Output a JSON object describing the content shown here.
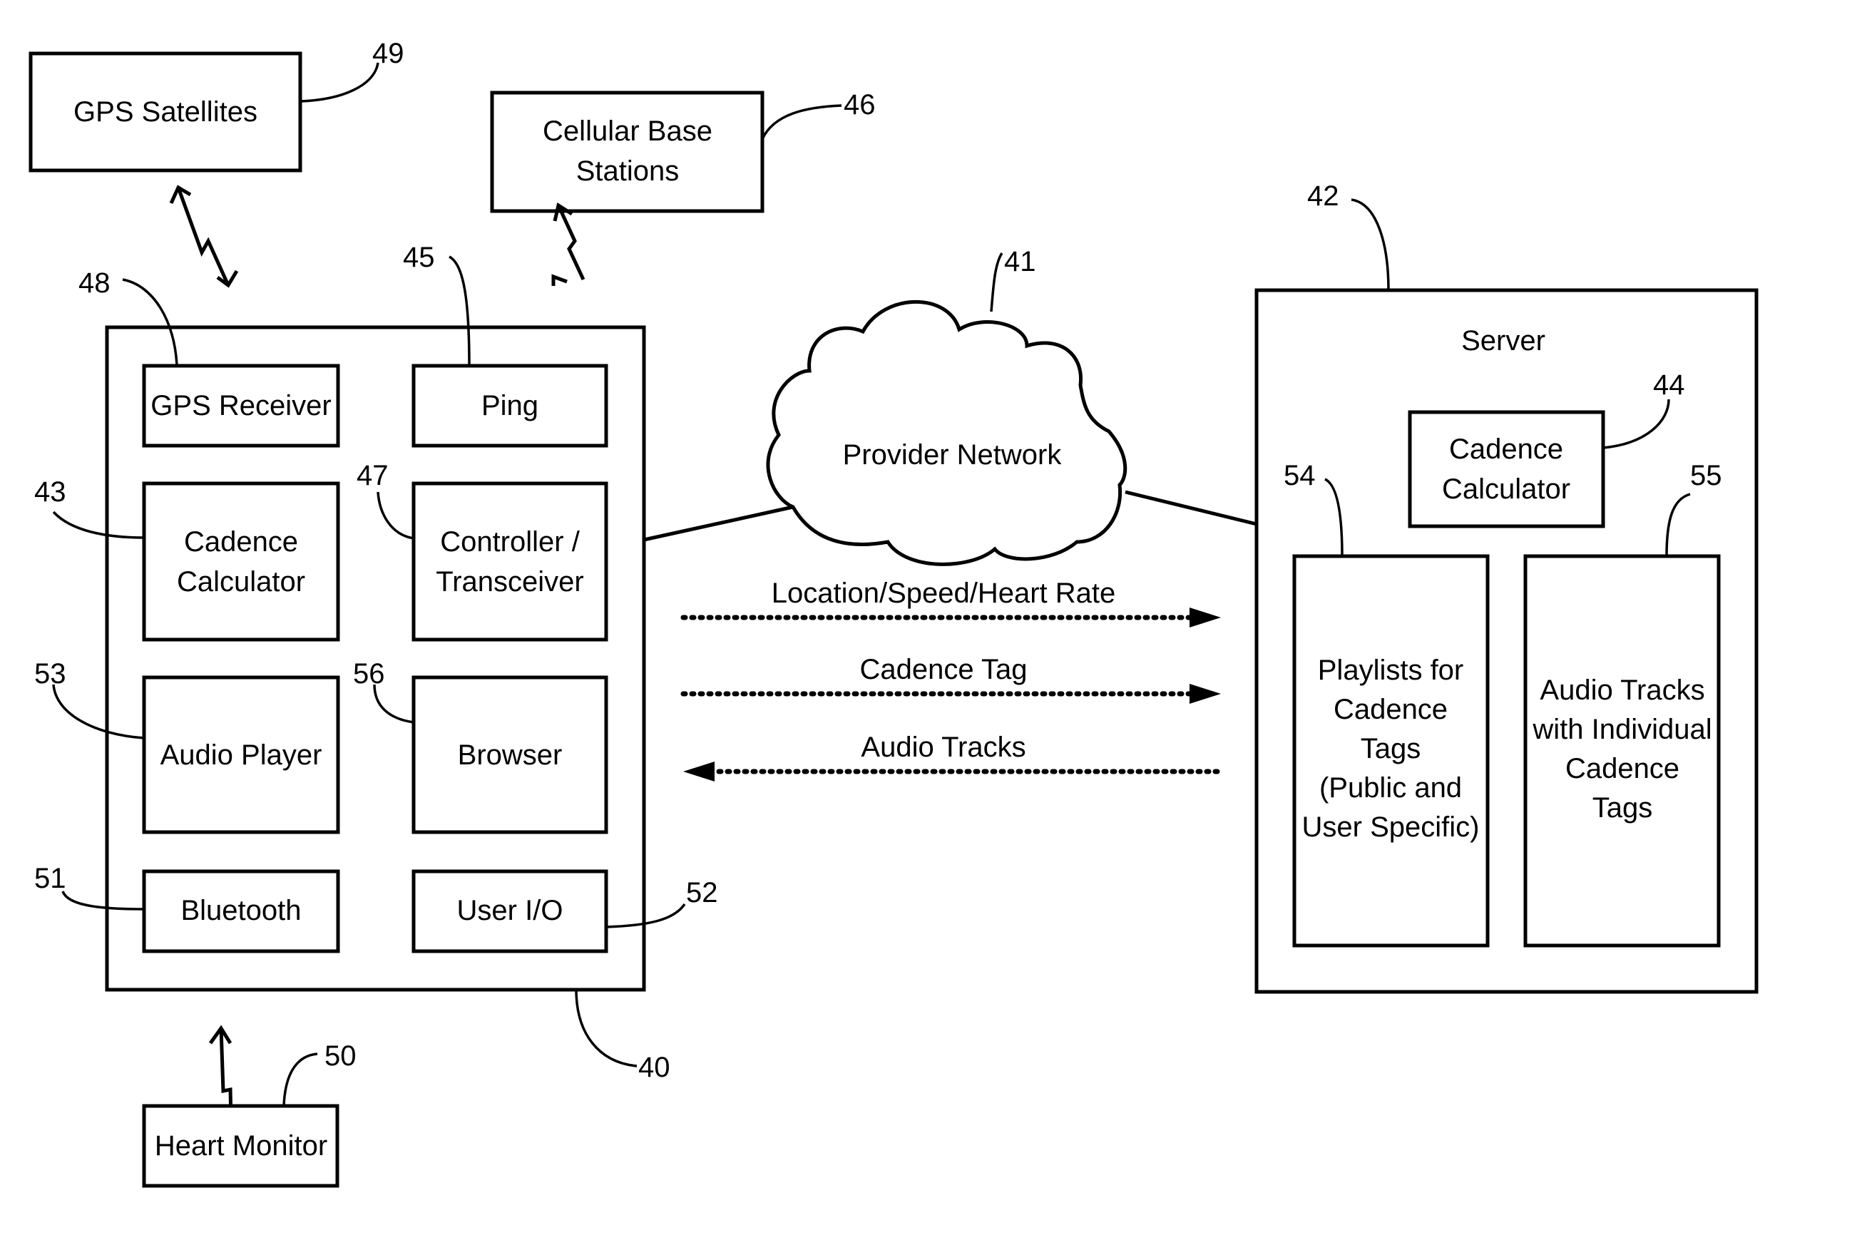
{
  "diagram": {
    "gps_satellites": {
      "label": "GPS Satellites",
      "ref": "49"
    },
    "cellular_base_stations": {
      "line1": "Cellular Base",
      "line2": "Stations",
      "ref": "46"
    },
    "mobile_device": {
      "ref": "40",
      "gps_receiver": {
        "label": "GPS Receiver",
        "ref": "48"
      },
      "ping": {
        "label": "Ping",
        "ref": "45"
      },
      "cadence_calculator": {
        "line1": "Cadence",
        "line2": "Calculator",
        "ref": "43"
      },
      "controller_transceiver": {
        "line1": "Controller /",
        "line2": "Transceiver",
        "ref": "47"
      },
      "audio_player": {
        "label": "Audio Player",
        "ref": "53"
      },
      "browser": {
        "label": "Browser",
        "ref": "56"
      },
      "bluetooth": {
        "label": "Bluetooth",
        "ref": "51"
      },
      "user_io": {
        "label": "User I/O",
        "ref": "52"
      }
    },
    "heart_monitor": {
      "label": "Heart Monitor",
      "ref": "50"
    },
    "provider_network": {
      "label": "Provider Network",
      "ref": "41"
    },
    "flows": [
      {
        "label": "Location/Speed/Heart Rate",
        "direction": "to-server"
      },
      {
        "label": "Cadence Tag",
        "direction": "to-server"
      },
      {
        "label": "Audio Tracks",
        "direction": "to-device"
      }
    ],
    "server": {
      "label": "Server",
      "ref": "42",
      "cadence_calculator": {
        "line1": "Cadence",
        "line2": "Calculator",
        "ref": "44"
      },
      "playlists": {
        "lines": [
          "Playlists for",
          "Cadence",
          "Tags",
          "(Public and",
          "User Specific)"
        ],
        "ref": "54"
      },
      "audio_tracks": {
        "lines": [
          "Audio Tracks",
          "with Individual",
          "Cadence",
          "Tags"
        ],
        "ref": "55"
      }
    }
  }
}
